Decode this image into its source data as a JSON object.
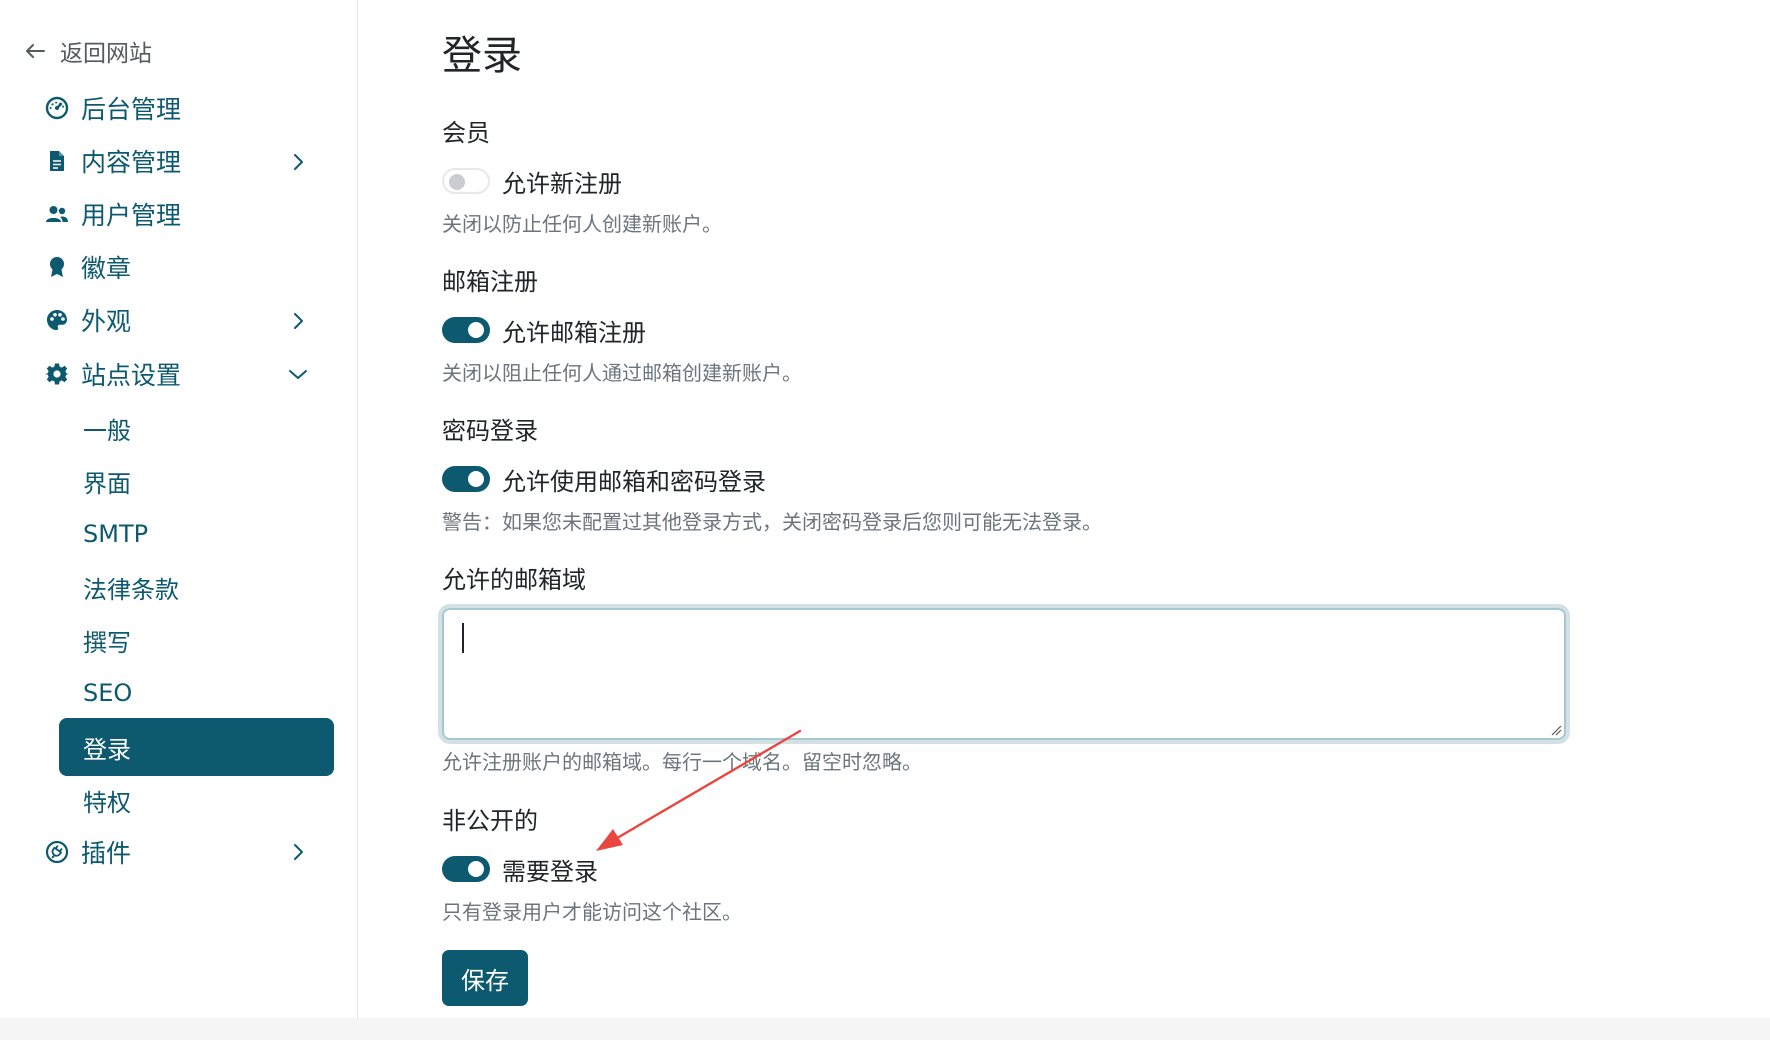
{
  "sidebar": {
    "back_label": "返回网站",
    "items": [
      {
        "label": "后台管理",
        "icon": "dashboard-gauge-icon"
      },
      {
        "label": "内容管理",
        "icon": "file-text-icon",
        "chevron": "right"
      },
      {
        "label": "用户管理",
        "icon": "users-icon"
      },
      {
        "label": "徽章",
        "icon": "award-badge-icon"
      },
      {
        "label": "外观",
        "icon": "palette-icon",
        "chevron": "right"
      },
      {
        "label": "站点设置",
        "icon": "gear-icon",
        "chevron": "down"
      }
    ],
    "sub_items": [
      {
        "label": "一般"
      },
      {
        "label": "界面"
      },
      {
        "label": "SMTP"
      },
      {
        "label": "法律条款"
      },
      {
        "label": "撰写"
      },
      {
        "label": "SEO"
      },
      {
        "label": "登录",
        "active": true
      },
      {
        "label": "特权"
      }
    ],
    "plugins": {
      "label": "插件",
      "icon": "plugin-icon",
      "chevron": "right"
    }
  },
  "main": {
    "title": "登录",
    "sections": {
      "membership": {
        "label": "会员",
        "toggle_label": "允许新注册",
        "enabled": false,
        "help": "关闭以防止任何人创建新账户。"
      },
      "email_registration": {
        "label": "邮箱注册",
        "toggle_label": "允许邮箱注册",
        "enabled": true,
        "help": "关闭以阻止任何人通过邮箱创建新账户。"
      },
      "password_login": {
        "label": "密码登录",
        "toggle_label": "允许使用邮箱和密码登录",
        "enabled": true,
        "help": "警告：如果您未配置过其他登录方式，关闭密码登录后您则可能无法登录。"
      },
      "allowed_domains": {
        "label": "允许的邮箱域",
        "value": "",
        "help": "允许注册账户的邮箱域。每行一个域名。留空时忽略。"
      },
      "private": {
        "label": "非公开的",
        "toggle_label": "需要登录",
        "enabled": true,
        "help": "只有登录用户才能访问这个社区。"
      }
    },
    "save_label": "保存"
  },
  "colors": {
    "accent": "#0c5970",
    "annotation_arrow": "#e8463f"
  }
}
